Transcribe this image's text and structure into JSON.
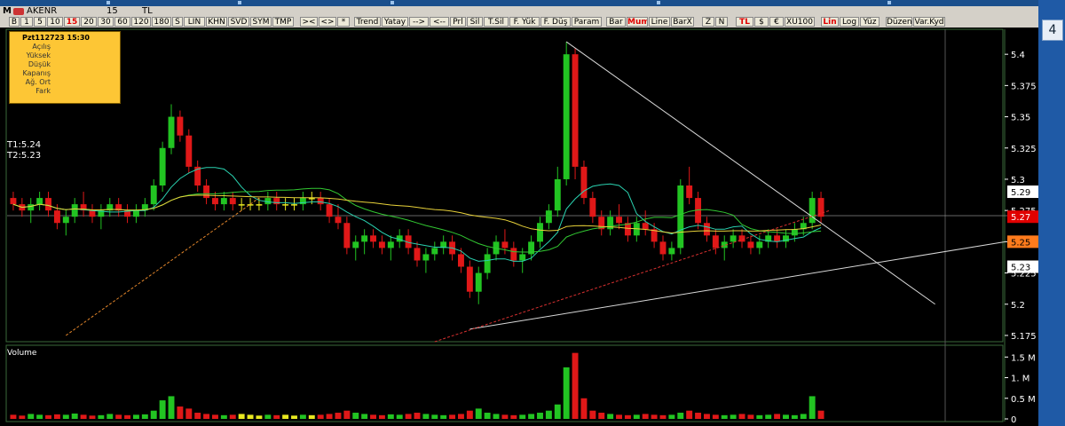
{
  "header": {
    "menu_label": "M",
    "symbol": "AKENR",
    "period": "15",
    "currency": "TL",
    "toolbar": [
      "B",
      "1",
      "5",
      "10",
      "15",
      "20",
      "30",
      "60",
      "120",
      "180",
      "S",
      "LIN",
      "KHN",
      "SVD",
      "SYM",
      "TMP",
      "><",
      "<>",
      "*",
      "Trend",
      "Yatay",
      "-->",
      "<--",
      "Prl",
      "Sil",
      "T.Sil",
      "F. Yük",
      "F. Düş",
      "Param",
      "Bar",
      "Mum",
      "Line",
      "BarX",
      "Z",
      "N",
      "TL",
      "$",
      "€",
      "XU100",
      "Lin",
      "Log",
      "Yüz",
      "Düzen",
      "Var.Kyd"
    ],
    "toolbar_active": [
      "15",
      "Mum",
      "TL",
      "Lin"
    ]
  },
  "side_panel": {
    "scroll_button": "4"
  },
  "info_box": {
    "date": "Pzt112723 15:30",
    "labels": [
      "Açılış",
      "Yüksek",
      "Düşük",
      "Kapanış",
      "Ağ. Ort",
      "Fark"
    ]
  },
  "targets": {
    "t1": "T1:5.24",
    "t2": "T2:5.23"
  },
  "price_axis": {
    "ticks": [
      "5.4",
      "5.375",
      "5.35",
      "5.325",
      "5.3",
      "5.275",
      "5.25",
      "5.225",
      "5.2",
      "5.175"
    ],
    "tick_values": [
      5.4,
      5.375,
      5.35,
      5.325,
      5.3,
      5.275,
      5.25,
      5.225,
      5.2,
      5.175
    ],
    "markers": [
      {
        "label": "5.29",
        "value": 5.29,
        "bg": "#ffffff",
        "fg": "#000000"
      },
      {
        "label": "5.27",
        "value": 5.27,
        "bg": "#e00000",
        "fg": "#ffffff"
      },
      {
        "label": "5.25",
        "value": 5.25,
        "bg": "#ff7b1c",
        "fg": "#000000"
      },
      {
        "label": "5.23",
        "value": 5.23,
        "bg": "#ffffff",
        "fg": "#000000"
      }
    ]
  },
  "volume_panel": {
    "title": "Volume",
    "ticks": [
      "1.5 M",
      "1. M",
      "0.5 M",
      "0"
    ],
    "tick_values": [
      1500000,
      1000000,
      500000,
      0
    ]
  },
  "chart_data": {
    "type": "candlestick",
    "symbol": "AKENR",
    "interval": "15",
    "y_range": [
      5.17,
      5.42
    ],
    "candles": [
      [
        5.285,
        5.29,
        5.275,
        5.28
      ],
      [
        5.28,
        5.285,
        5.27,
        5.275
      ],
      [
        5.275,
        5.285,
        5.265,
        5.28
      ],
      [
        5.28,
        5.29,
        5.275,
        5.285
      ],
      [
        5.285,
        5.29,
        5.27,
        5.275
      ],
      [
        5.275,
        5.28,
        5.26,
        5.265
      ],
      [
        5.265,
        5.275,
        5.255,
        5.27
      ],
      [
        5.27,
        5.285,
        5.265,
        5.28
      ],
      [
        5.28,
        5.29,
        5.27,
        5.275
      ],
      [
        5.275,
        5.28,
        5.265,
        5.27
      ],
      [
        5.27,
        5.28,
        5.26,
        5.275
      ],
      [
        5.275,
        5.285,
        5.27,
        5.28
      ],
      [
        5.28,
        5.285,
        5.27,
        5.275
      ],
      [
        5.275,
        5.28,
        5.265,
        5.27
      ],
      [
        5.27,
        5.28,
        5.265,
        5.275
      ],
      [
        5.275,
        5.285,
        5.27,
        5.28
      ],
      [
        5.28,
        5.3,
        5.275,
        5.295
      ],
      [
        5.295,
        5.33,
        5.29,
        5.325
      ],
      [
        5.325,
        5.36,
        5.32,
        5.35
      ],
      [
        5.35,
        5.355,
        5.33,
        5.335
      ],
      [
        5.335,
        5.34,
        5.305,
        5.31
      ],
      [
        5.31,
        5.315,
        5.29,
        5.295
      ],
      [
        5.295,
        5.3,
        5.28,
        5.285
      ],
      [
        5.285,
        5.29,
        5.275,
        5.28
      ],
      [
        5.28,
        5.29,
        5.275,
        5.285
      ],
      [
        5.285,
        5.29,
        5.275,
        5.28
      ],
      [
        5.28,
        5.285,
        5.275,
        5.28
      ],
      [
        5.28,
        5.285,
        5.275,
        5.28
      ],
      [
        5.28,
        5.285,
        5.275,
        5.28
      ],
      [
        5.28,
        5.29,
        5.275,
        5.285
      ],
      [
        5.285,
        5.29,
        5.275,
        5.28
      ],
      [
        5.28,
        5.285,
        5.275,
        5.28
      ],
      [
        5.28,
        5.285,
        5.275,
        5.28
      ],
      [
        5.28,
        5.29,
        5.275,
        5.285
      ],
      [
        5.285,
        5.29,
        5.28,
        5.285
      ],
      [
        5.285,
        5.29,
        5.275,
        5.28
      ],
      [
        5.28,
        5.285,
        5.265,
        5.27
      ],
      [
        5.27,
        5.28,
        5.26,
        5.265
      ],
      [
        5.265,
        5.27,
        5.24,
        5.245
      ],
      [
        5.245,
        5.255,
        5.235,
        5.25
      ],
      [
        5.25,
        5.26,
        5.24,
        5.255
      ],
      [
        5.255,
        5.26,
        5.245,
        5.25
      ],
      [
        5.25,
        5.255,
        5.24,
        5.245
      ],
      [
        5.245,
        5.255,
        5.235,
        5.25
      ],
      [
        5.25,
        5.26,
        5.245,
        5.255
      ],
      [
        5.255,
        5.26,
        5.24,
        5.245
      ],
      [
        5.245,
        5.25,
        5.23,
        5.235
      ],
      [
        5.235,
        5.245,
        5.225,
        5.24
      ],
      [
        5.24,
        5.25,
        5.235,
        5.245
      ],
      [
        5.245,
        5.255,
        5.24,
        5.25
      ],
      [
        5.25,
        5.255,
        5.235,
        5.24
      ],
      [
        5.24,
        5.245,
        5.225,
        5.23
      ],
      [
        5.23,
        5.235,
        5.205,
        5.21
      ],
      [
        5.21,
        5.23,
        5.2,
        5.225
      ],
      [
        5.225,
        5.245,
        5.22,
        5.24
      ],
      [
        5.24,
        5.255,
        5.235,
        5.25
      ],
      [
        5.25,
        5.26,
        5.24,
        5.245
      ],
      [
        5.245,
        5.25,
        5.23,
        5.235
      ],
      [
        5.235,
        5.245,
        5.225,
        5.24
      ],
      [
        5.24,
        5.255,
        5.235,
        5.25
      ],
      [
        5.25,
        5.27,
        5.245,
        5.265
      ],
      [
        5.265,
        5.28,
        5.26,
        5.275
      ],
      [
        5.275,
        5.31,
        5.27,
        5.3
      ],
      [
        5.3,
        5.41,
        5.295,
        5.4
      ],
      [
        5.4,
        5.405,
        5.3,
        5.31
      ],
      [
        5.31,
        5.315,
        5.28,
        5.285
      ],
      [
        5.285,
        5.29,
        5.265,
        5.27
      ],
      [
        5.27,
        5.275,
        5.255,
        5.26
      ],
      [
        5.26,
        5.275,
        5.255,
        5.27
      ],
      [
        5.27,
        5.28,
        5.26,
        5.265
      ],
      [
        5.265,
        5.27,
        5.25,
        5.255
      ],
      [
        5.255,
        5.27,
        5.25,
        5.265
      ],
      [
        5.265,
        5.275,
        5.255,
        5.26
      ],
      [
        5.26,
        5.265,
        5.245,
        5.25
      ],
      [
        5.25,
        5.255,
        5.235,
        5.24
      ],
      [
        5.24,
        5.25,
        5.235,
        5.245
      ],
      [
        5.245,
        5.3,
        5.24,
        5.295
      ],
      [
        5.295,
        5.31,
        5.28,
        5.285
      ],
      [
        5.285,
        5.29,
        5.26,
        5.265
      ],
      [
        5.265,
        5.27,
        5.25,
        5.255
      ],
      [
        5.255,
        5.26,
        5.24,
        5.245
      ],
      [
        5.245,
        5.255,
        5.235,
        5.25
      ],
      [
        5.25,
        5.26,
        5.245,
        5.255
      ],
      [
        5.255,
        5.26,
        5.245,
        5.25
      ],
      [
        5.25,
        5.255,
        5.24,
        5.245
      ],
      [
        5.245,
        5.255,
        5.24,
        5.25
      ],
      [
        5.25,
        5.26,
        5.245,
        5.255
      ],
      [
        5.255,
        5.26,
        5.245,
        5.25
      ],
      [
        5.25,
        5.26,
        5.245,
        5.255
      ],
      [
        5.255,
        5.265,
        5.25,
        5.26
      ],
      [
        5.26,
        5.27,
        5.255,
        5.265
      ],
      [
        5.265,
        5.29,
        5.26,
        5.285
      ],
      [
        5.285,
        5.29,
        5.265,
        5.27
      ]
    ],
    "volume": [
      0.1,
      0.08,
      0.12,
      0.1,
      0.09,
      0.11,
      0.1,
      0.13,
      0.1,
      0.08,
      0.09,
      0.12,
      0.1,
      0.09,
      0.1,
      0.11,
      0.2,
      0.45,
      0.55,
      0.3,
      0.25,
      0.15,
      0.12,
      0.1,
      0.09,
      0.1,
      0.12,
      0.1,
      0.08,
      0.1,
      0.09,
      0.1,
      0.08,
      0.1,
      0.09,
      0.1,
      0.12,
      0.15,
      0.2,
      0.15,
      0.12,
      0.1,
      0.09,
      0.11,
      0.1,
      0.12,
      0.15,
      0.12,
      0.1,
      0.09,
      0.1,
      0.12,
      0.2,
      0.25,
      0.15,
      0.12,
      0.1,
      0.09,
      0.1,
      0.12,
      0.15,
      0.2,
      0.35,
      1.25,
      1.6,
      0.5,
      0.2,
      0.15,
      0.12,
      0.1,
      0.09,
      0.1,
      0.12,
      0.1,
      0.09,
      0.1,
      0.15,
      0.2,
      0.15,
      0.12,
      0.1,
      0.09,
      0.1,
      0.12,
      0.1,
      0.09,
      0.1,
      0.12,
      0.1,
      0.09,
      0.12,
      0.55,
      0.2
    ]
  }
}
